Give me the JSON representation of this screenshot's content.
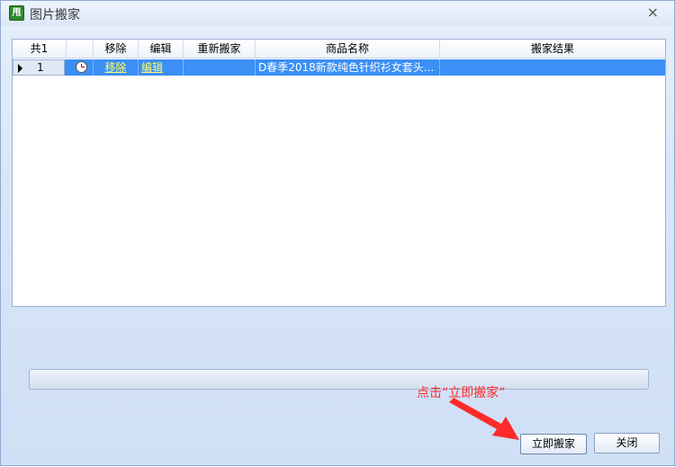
{
  "window": {
    "title": "图片搬家",
    "app_icon_text": "甩",
    "close_glyph": "×"
  },
  "table": {
    "columns": [
      "共1",
      "",
      "移除",
      "编辑",
      "重新搬家",
      "商品名称",
      "搬家结果"
    ],
    "rows": [
      {
        "index": "1",
        "status_icon": "clock-icon",
        "remove": "移除",
        "edit": "编辑",
        "remove_again": "",
        "product_name": "D春季2018新款纯色针织衫女套头...",
        "result": ""
      }
    ]
  },
  "progress": {
    "value": 0
  },
  "annotation": {
    "text": "点击“立即搬家”",
    "color": "#ff2a2a"
  },
  "buttons": {
    "move_now": "立即搬家",
    "close": "关闭"
  },
  "colors": {
    "selected_row": "#3b8ff5",
    "link": "#ffff66"
  }
}
